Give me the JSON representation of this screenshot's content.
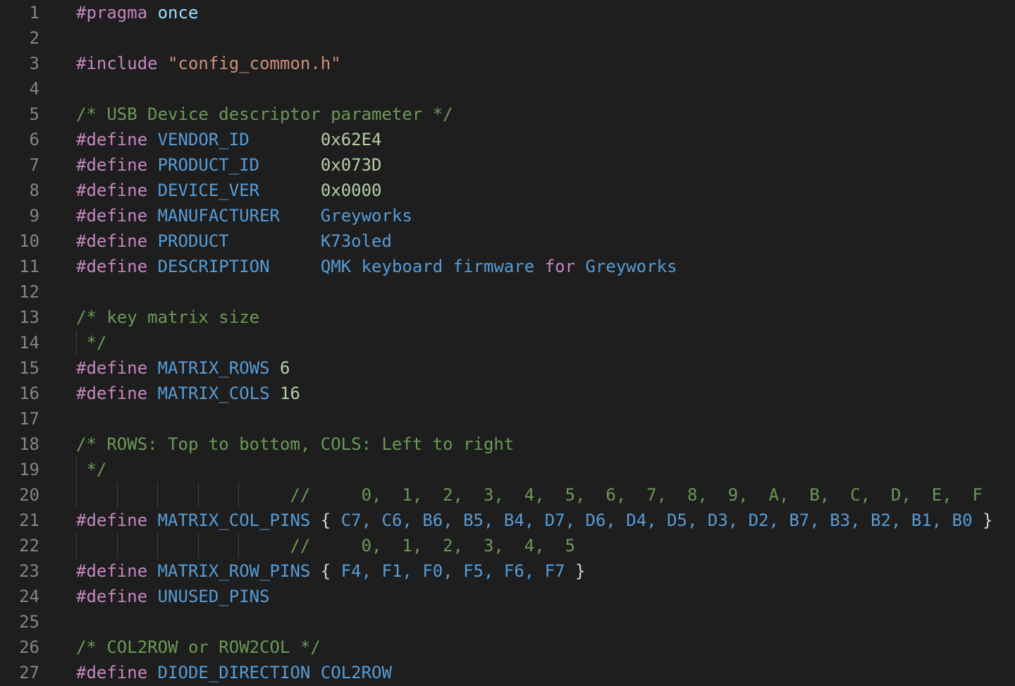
{
  "colors": {
    "background": "#1e1e1e",
    "line_number": "#858585",
    "directive": "#c586c0",
    "macro": "#569cd6",
    "text": "#d4d4d4",
    "string": "#ce9178",
    "number": "#b5cea8",
    "comment": "#6a9955",
    "identifier": "#9cdcfe",
    "indent_guide": "#404040"
  },
  "editor": {
    "lines": [
      {
        "num": "1",
        "tokens": [
          {
            "t": "#pragma",
            "k": "directive"
          },
          {
            "t": " ",
            "k": "text"
          },
          {
            "t": "once",
            "k": "identifier"
          }
        ]
      },
      {
        "num": "2",
        "tokens": []
      },
      {
        "num": "3",
        "tokens": [
          {
            "t": "#include",
            "k": "directive"
          },
          {
            "t": " ",
            "k": "text"
          },
          {
            "t": "\"config_common.h\"",
            "k": "string"
          }
        ]
      },
      {
        "num": "4",
        "tokens": []
      },
      {
        "num": "5",
        "tokens": [
          {
            "t": "/* USB Device descriptor parameter */",
            "k": "comment"
          }
        ]
      },
      {
        "num": "6",
        "tokens": [
          {
            "t": "#define",
            "k": "directive"
          },
          {
            "t": " ",
            "k": "text"
          },
          {
            "t": "VENDOR_ID",
            "k": "macro"
          },
          {
            "t": "       ",
            "k": "text"
          },
          {
            "t": "0x62E4",
            "k": "number"
          }
        ]
      },
      {
        "num": "7",
        "tokens": [
          {
            "t": "#define",
            "k": "directive"
          },
          {
            "t": " ",
            "k": "text"
          },
          {
            "t": "PRODUCT_ID",
            "k": "macro"
          },
          {
            "t": "      ",
            "k": "text"
          },
          {
            "t": "0x073D",
            "k": "number"
          }
        ]
      },
      {
        "num": "8",
        "tokens": [
          {
            "t": "#define",
            "k": "directive"
          },
          {
            "t": " ",
            "k": "text"
          },
          {
            "t": "DEVICE_VER",
            "k": "macro"
          },
          {
            "t": "      ",
            "k": "text"
          },
          {
            "t": "0x0000",
            "k": "number"
          }
        ]
      },
      {
        "num": "9",
        "tokens": [
          {
            "t": "#define",
            "k": "directive"
          },
          {
            "t": " ",
            "k": "text"
          },
          {
            "t": "MANUFACTURER",
            "k": "macro"
          },
          {
            "t": "    ",
            "k": "text"
          },
          {
            "t": "Greyworks",
            "k": "macro"
          }
        ]
      },
      {
        "num": "10",
        "tokens": [
          {
            "t": "#define",
            "k": "directive"
          },
          {
            "t": " ",
            "k": "text"
          },
          {
            "t": "PRODUCT",
            "k": "macro"
          },
          {
            "t": "         ",
            "k": "text"
          },
          {
            "t": "K73oled",
            "k": "macro"
          }
        ]
      },
      {
        "num": "11",
        "tokens": [
          {
            "t": "#define",
            "k": "directive"
          },
          {
            "t": " ",
            "k": "text"
          },
          {
            "t": "DESCRIPTION",
            "k": "macro"
          },
          {
            "t": "     ",
            "k": "text"
          },
          {
            "t": "QMK keyboard firmware ",
            "k": "macro"
          },
          {
            "t": "for",
            "k": "directive"
          },
          {
            "t": " Greyworks",
            "k": "macro"
          }
        ]
      },
      {
        "num": "12",
        "tokens": []
      },
      {
        "num": "13",
        "tokens": [
          {
            "t": "/* key matrix size",
            "k": "comment"
          }
        ]
      },
      {
        "num": "14",
        "tokens": [
          {
            "t": " */",
            "k": "comment"
          }
        ],
        "guides": 1
      },
      {
        "num": "15",
        "tokens": [
          {
            "t": "#define",
            "k": "directive"
          },
          {
            "t": " ",
            "k": "text"
          },
          {
            "t": "MATRIX_ROWS",
            "k": "macro"
          },
          {
            "t": " ",
            "k": "text"
          },
          {
            "t": "6",
            "k": "number"
          }
        ]
      },
      {
        "num": "16",
        "tokens": [
          {
            "t": "#define",
            "k": "directive"
          },
          {
            "t": " ",
            "k": "text"
          },
          {
            "t": "MATRIX_COLS",
            "k": "macro"
          },
          {
            "t": " ",
            "k": "text"
          },
          {
            "t": "16",
            "k": "number"
          }
        ]
      },
      {
        "num": "17",
        "tokens": []
      },
      {
        "num": "18",
        "tokens": [
          {
            "t": "/* ROWS: Top to bottom, COLS: Left to right",
            "k": "comment"
          }
        ]
      },
      {
        "num": "19",
        "tokens": [
          {
            "t": " */",
            "k": "comment"
          }
        ],
        "guides": 1
      },
      {
        "num": "20",
        "tokens": [
          {
            "t": "                     ",
            "k": "text"
          },
          {
            "t": "//     0,  1,  2,  3,  4,  5,  6,  7,  8,  9,  A,  B,  C,  D,  E,  F",
            "k": "comment"
          }
        ],
        "guides": 5
      },
      {
        "num": "21",
        "tokens": [
          {
            "t": "#define",
            "k": "directive"
          },
          {
            "t": " ",
            "k": "text"
          },
          {
            "t": "MATRIX_COL_PINS",
            "k": "macro"
          },
          {
            "t": " { ",
            "k": "text"
          },
          {
            "t": "C7, C6, B6, B5, B4, D7, D6, D4, D5, D3, D2, B7, B3, B2, B1, B0",
            "k": "macro"
          },
          {
            "t": " }",
            "k": "text"
          }
        ]
      },
      {
        "num": "22",
        "tokens": [
          {
            "t": "                     ",
            "k": "text"
          },
          {
            "t": "//     0,  1,  2,  3,  4,  5",
            "k": "comment"
          }
        ],
        "guides": 5
      },
      {
        "num": "23",
        "tokens": [
          {
            "t": "#define",
            "k": "directive"
          },
          {
            "t": " ",
            "k": "text"
          },
          {
            "t": "MATRIX_ROW_PINS",
            "k": "macro"
          },
          {
            "t": " { ",
            "k": "text"
          },
          {
            "t": "F4, F1, F0, F5, F6, F7",
            "k": "macro"
          },
          {
            "t": " }",
            "k": "text"
          }
        ]
      },
      {
        "num": "24",
        "tokens": [
          {
            "t": "#define",
            "k": "directive"
          },
          {
            "t": " ",
            "k": "text"
          },
          {
            "t": "UNUSED_PINS",
            "k": "macro"
          }
        ]
      },
      {
        "num": "25",
        "tokens": []
      },
      {
        "num": "26",
        "tokens": [
          {
            "t": "/* COL2ROW or ROW2COL */",
            "k": "comment"
          }
        ]
      },
      {
        "num": "27",
        "tokens": [
          {
            "t": "#define",
            "k": "directive"
          },
          {
            "t": " ",
            "k": "text"
          },
          {
            "t": "DIODE_DIRECTION",
            "k": "macro"
          },
          {
            "t": " ",
            "k": "text"
          },
          {
            "t": "COL2ROW",
            "k": "macro"
          }
        ]
      }
    ]
  }
}
